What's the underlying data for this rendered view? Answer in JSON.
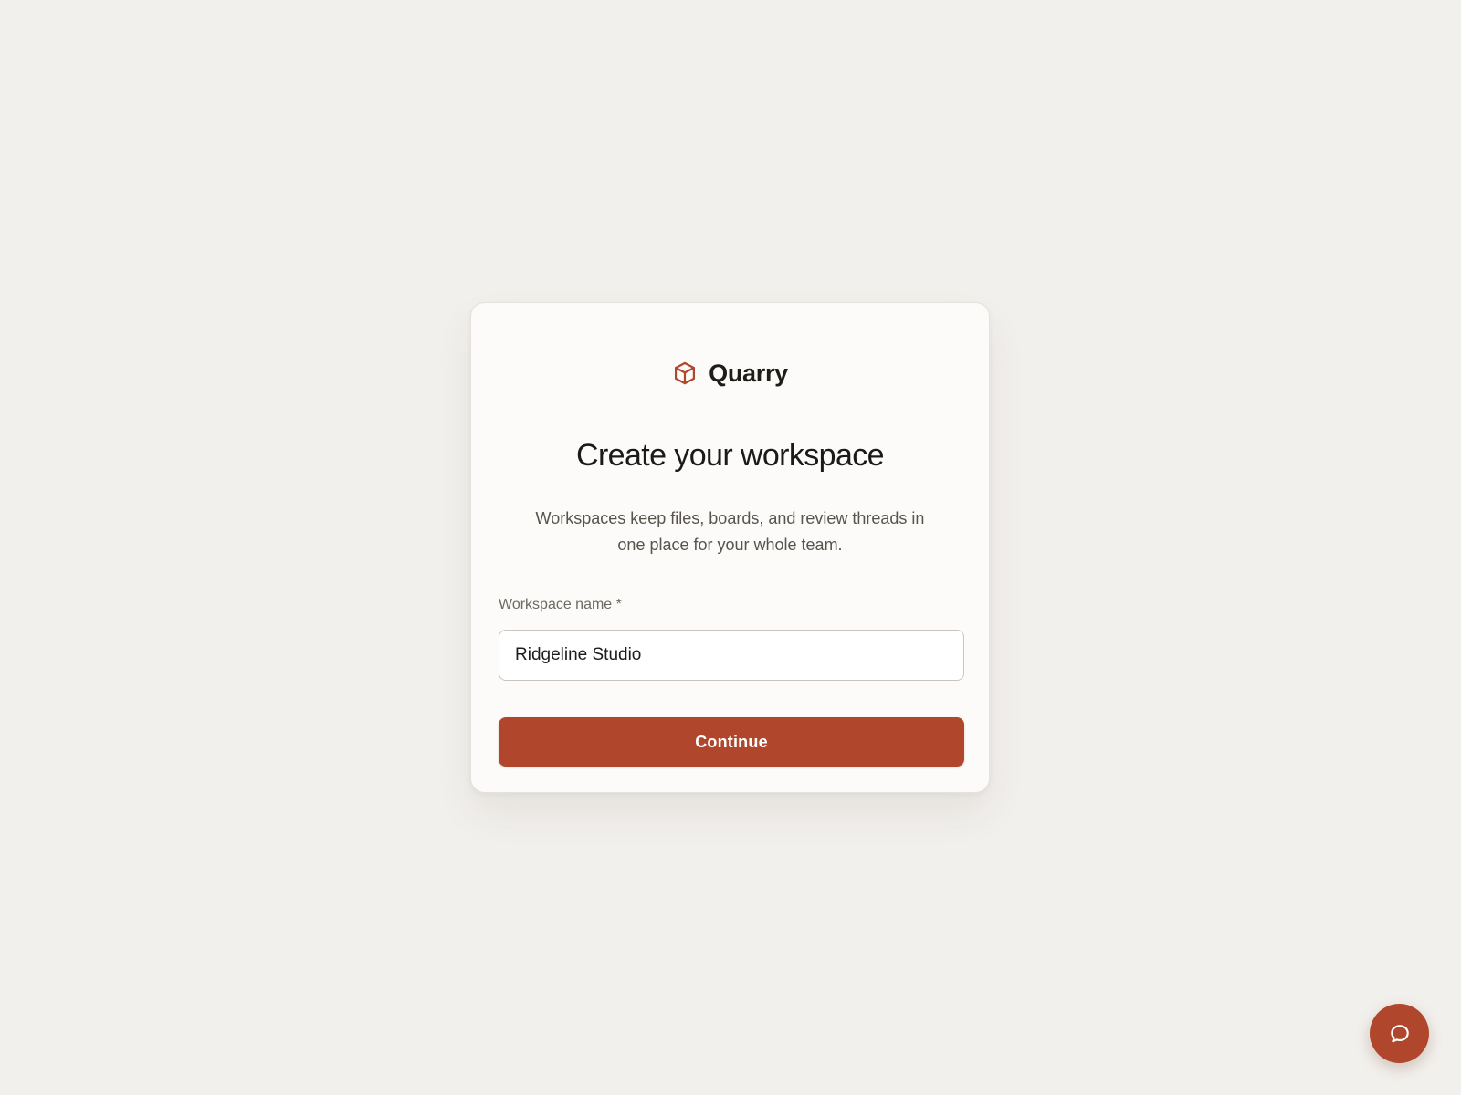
{
  "brand": {
    "name": "Quarry",
    "icon": "cube-icon",
    "accent_color": "#b0472d"
  },
  "card": {
    "title": "Create your workspace",
    "subtitle": "Workspaces keep files, boards, and review threads in one place for your whole team.",
    "field": {
      "label": "Workspace name *",
      "value": "Ridgeline Studio"
    },
    "continue_label": "Continue"
  },
  "chat": {
    "icon": "chat-bubble-icon"
  }
}
